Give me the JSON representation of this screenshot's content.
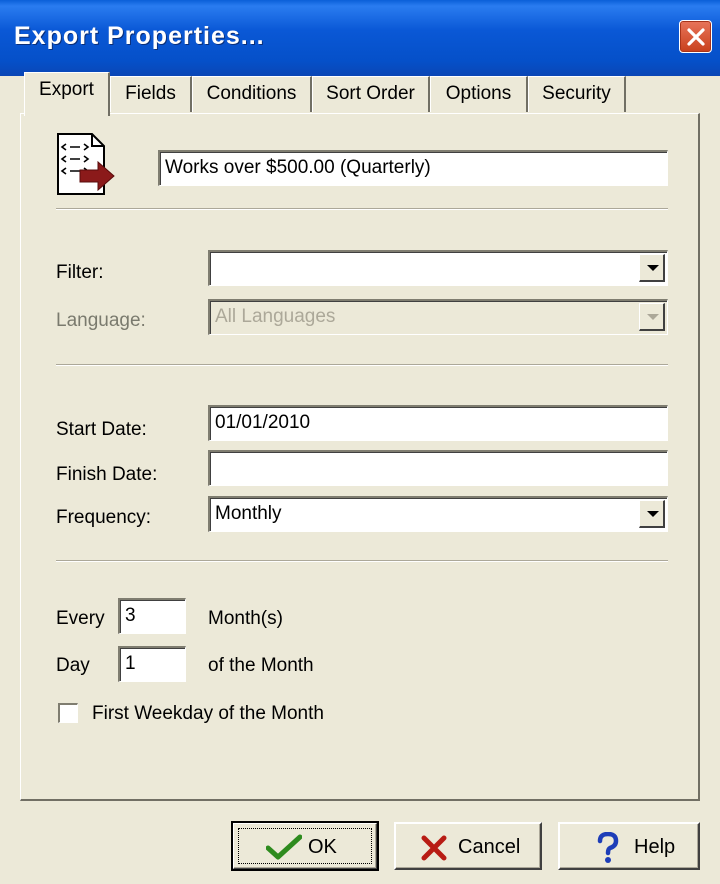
{
  "window": {
    "title": "Export Properties..."
  },
  "tabs": [
    {
      "label": "Export",
      "active": true
    },
    {
      "label": "Fields"
    },
    {
      "label": "Conditions"
    },
    {
      "label": "Sort Order"
    },
    {
      "label": "Options"
    },
    {
      "label": "Security"
    }
  ],
  "export": {
    "name_value": "Works over $500.00 (Quarterly)",
    "filter": {
      "label": "Filter:",
      "value": ""
    },
    "language": {
      "label": "Language:",
      "value": "All Languages",
      "disabled": true
    },
    "start_date": {
      "label": "Start Date:",
      "value": "01/01/2010"
    },
    "finish_date": {
      "label": "Finish Date:",
      "value": ""
    },
    "frequency": {
      "label": "Frequency:",
      "value": "Monthly"
    },
    "every": {
      "label": "Every",
      "value": "3",
      "suffix": "Month(s)"
    },
    "day": {
      "label": "Day",
      "value": "1",
      "suffix": "of the Month"
    },
    "first_weekday": {
      "label": "First Weekday of the Month",
      "checked": false
    }
  },
  "buttons": {
    "ok": "OK",
    "cancel": "Cancel",
    "help": "Help"
  },
  "colors": {
    "titlebar": "#0a58d6",
    "dialog_bg": "#ece9d8",
    "ok_check": "#2e8b1e",
    "cancel_x": "#b81c14",
    "help_q": "#1d3db8",
    "export_arrow": "#8b1a1a"
  },
  "icons": {
    "close": "close-icon",
    "export_doc": "export-document-icon",
    "ok": "checkmark-icon",
    "cancel": "x-icon",
    "help": "question-mark-icon"
  }
}
